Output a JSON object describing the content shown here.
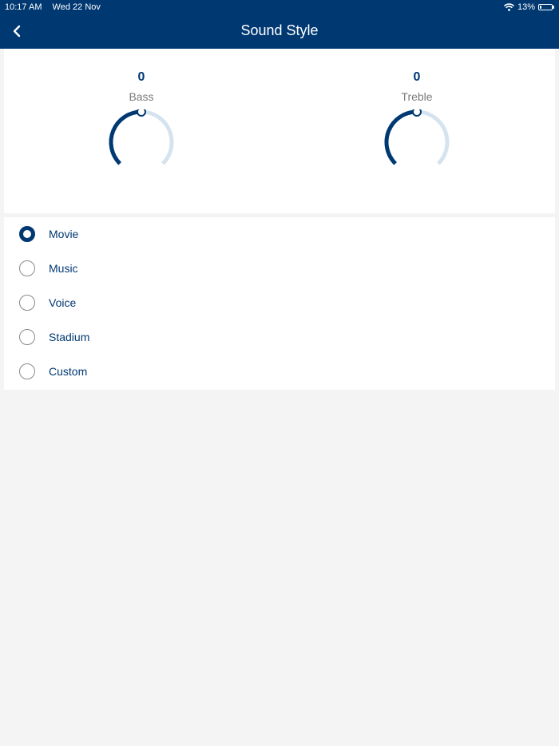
{
  "status_bar": {
    "time": "10:17 AM",
    "date": "Wed 22 Nov",
    "battery_text": "13%",
    "battery_level": 0.13
  },
  "header": {
    "title": "Sound Style",
    "back_icon": "chevron-left-icon"
  },
  "equalizer": {
    "bass": {
      "value": "0",
      "label": "Bass",
      "level": 0.5
    },
    "treble": {
      "value": "0",
      "label": "Treble",
      "level": 0.5
    }
  },
  "sound_styles": {
    "selected": "Movie",
    "options": [
      "Movie",
      "Music",
      "Voice",
      "Stadium",
      "Custom"
    ]
  },
  "colors": {
    "primary": "#003872",
    "track": "#d5e3ef",
    "background": "#f4f4f4"
  }
}
